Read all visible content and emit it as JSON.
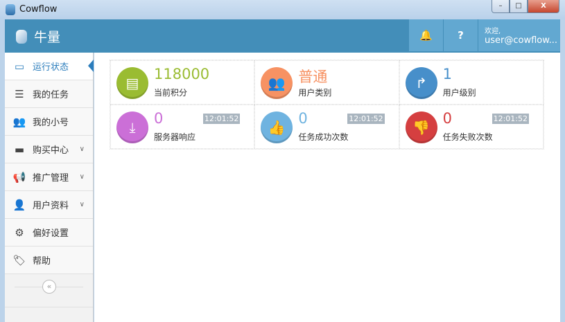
{
  "window": {
    "title": "Cowflow",
    "minimize": "–",
    "maximize": "□",
    "close": "X"
  },
  "header": {
    "brand": "牛量",
    "bell_icon": "bell-icon",
    "help_label": "?",
    "welcome": "欢迎,",
    "user": "user@cowflow..."
  },
  "sidebar": {
    "items": [
      {
        "label": "运行状态",
        "icon": "monitor-icon",
        "glyph": "▭",
        "active": true
      },
      {
        "label": "我的任务",
        "icon": "tasks-icon",
        "glyph": "☰"
      },
      {
        "label": "我的小号",
        "icon": "users-icon",
        "glyph": "👥"
      },
      {
        "label": "购买中心",
        "icon": "credit-card-icon",
        "glyph": "▬",
        "chevron": "∨"
      },
      {
        "label": "推广管理",
        "icon": "bullhorn-icon",
        "glyph": "📢",
        "chevron": "∨"
      },
      {
        "label": "用户资料",
        "icon": "user-icon",
        "glyph": "👤",
        "chevron": "∨"
      },
      {
        "label": "偏好设置",
        "icon": "gears-icon",
        "glyph": "⚙"
      },
      {
        "label": "帮助",
        "icon": "tag-icon",
        "glyph": "🏷"
      }
    ],
    "collapse": "«"
  },
  "stats": [
    {
      "value": "118000",
      "label": "当前积分",
      "color": "#9abc32",
      "glyph": "▤",
      "icon": "credit-card-icon"
    },
    {
      "value": "普通",
      "label": "用户类别",
      "color": "#f79263",
      "glyph": "👥",
      "icon": "users-icon"
    },
    {
      "value": "1",
      "label": "用户级别",
      "color": "#478fca",
      "glyph": "↱",
      "icon": "level-up-icon"
    },
    {
      "value": "0",
      "label": "服务器响应",
      "color": "#cb6fd7",
      "glyph": "⤓",
      "icon": "download-icon",
      "time": "12:01:52"
    },
    {
      "value": "0",
      "label": "任务成功次数",
      "color": "#6fb3e0",
      "glyph": "👍",
      "icon": "thumbs-up-icon",
      "time": "12:01:52"
    },
    {
      "value": "0",
      "label": "任务失败次数",
      "color": "#d53f40",
      "glyph": "👎",
      "icon": "thumbs-down-icon",
      "time": "12:01:52"
    }
  ]
}
